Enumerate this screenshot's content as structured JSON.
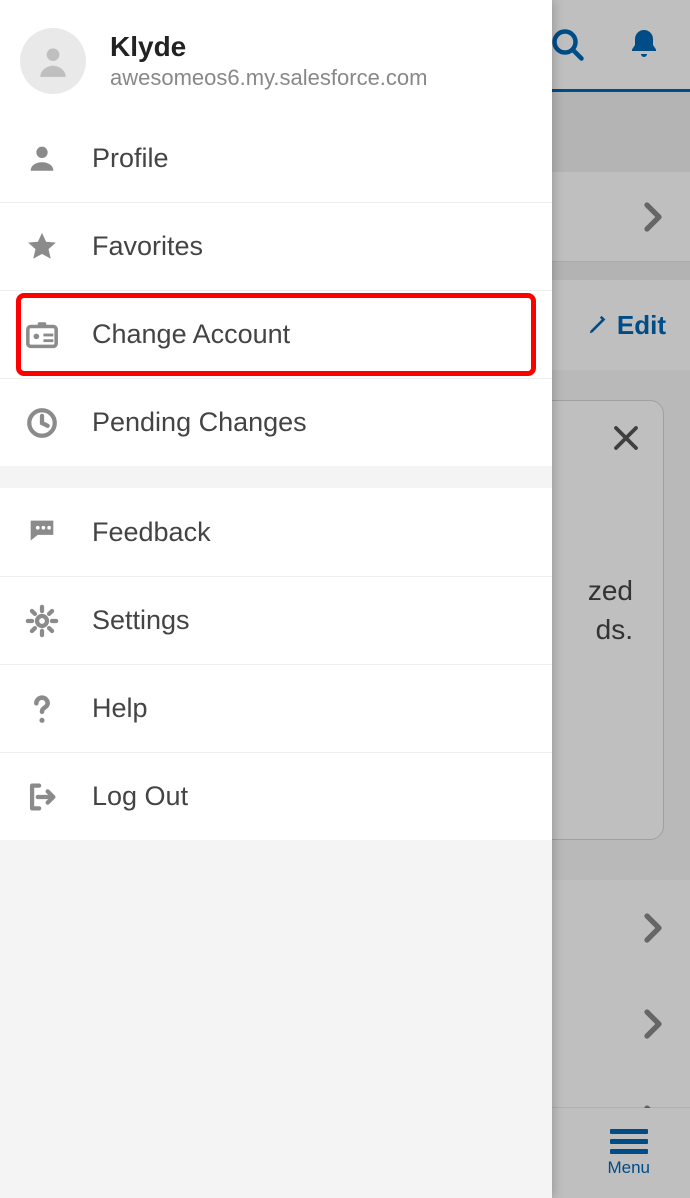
{
  "user": {
    "name": "Klyde",
    "org": "awesomeos6.my.salesforce.com"
  },
  "drawer": {
    "group1": [
      {
        "label": "Profile"
      },
      {
        "label": "Favorites"
      },
      {
        "label": "Change Account",
        "highlighted": true
      },
      {
        "label": "Pending Changes"
      }
    ],
    "group2": [
      {
        "label": "Feedback"
      },
      {
        "label": "Settings"
      },
      {
        "label": "Help"
      },
      {
        "label": "Log Out"
      }
    ]
  },
  "backdrop": {
    "edit_label": "Edit",
    "card_text_line1": "zed",
    "card_text_line2": "ds.",
    "menu_label": "Menu"
  }
}
